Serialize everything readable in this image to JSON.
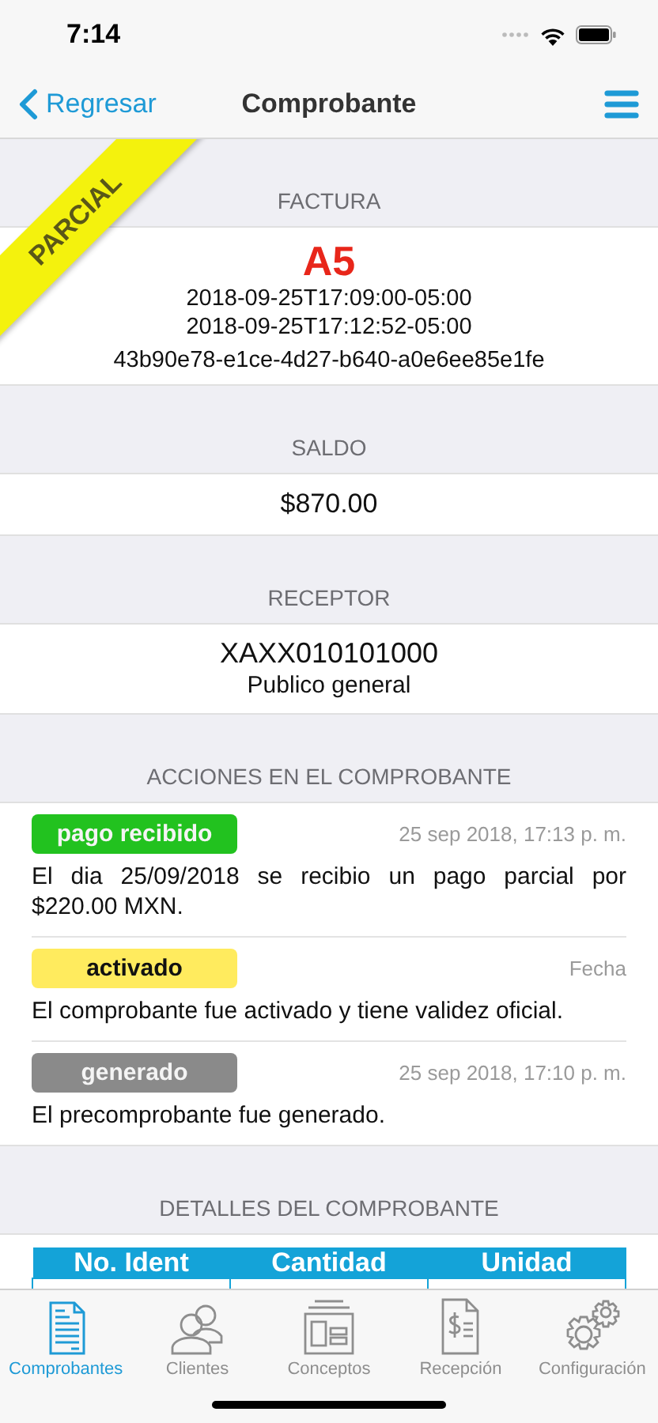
{
  "status_bar": {
    "time": "7:14"
  },
  "nav": {
    "back": "Regresar",
    "title": "Comprobante"
  },
  "ribbon": {
    "label": "PARCIAL"
  },
  "factura": {
    "header": "FACTURA",
    "serie": "A5",
    "dates": [
      "2018-09-25T17:09:00-05:00",
      "2018-09-25T17:12:52-05:00"
    ],
    "uuid": "43b90e78-e1ce-4d27-b640-a0e6ee85e1fe"
  },
  "saldo": {
    "header": "SALDO",
    "amount": "$870.00"
  },
  "receptor": {
    "header": "RECEPTOR",
    "rfc": "XAXX010101000",
    "name": "Publico general"
  },
  "acciones": {
    "header": "ACCIONES EN EL COMPROBANTE",
    "items": [
      {
        "label": "pago recibido",
        "color": "#22c21f",
        "date": "25 sep 2018, 17:13 p. m.",
        "description": "El dia 25/09/2018 se recibio un pago parcial por $220.00 MXN."
      },
      {
        "label": "activado",
        "color": "#ffeb5e",
        "date": "Fecha",
        "description": "El comprobante fue activado y tiene validez oficial."
      },
      {
        "label": "generado",
        "color": "#8a8a8a",
        "date": "25 sep 2018, 17:10 p. m.",
        "description": "El precomprobante fue generado."
      }
    ]
  },
  "detalles": {
    "header": "DETALLES DEL COMPROBANTE",
    "columns": [
      "No. Ident",
      "Cantidad",
      "Unidad"
    ]
  },
  "tab_bar": {
    "items": [
      {
        "label": "Comprobantes",
        "selected": true
      },
      {
        "label": "Clientes",
        "selected": false
      },
      {
        "label": "Conceptos",
        "selected": false
      },
      {
        "label": "Recepción",
        "selected": false
      },
      {
        "label": "Configuración",
        "selected": false
      }
    ]
  }
}
